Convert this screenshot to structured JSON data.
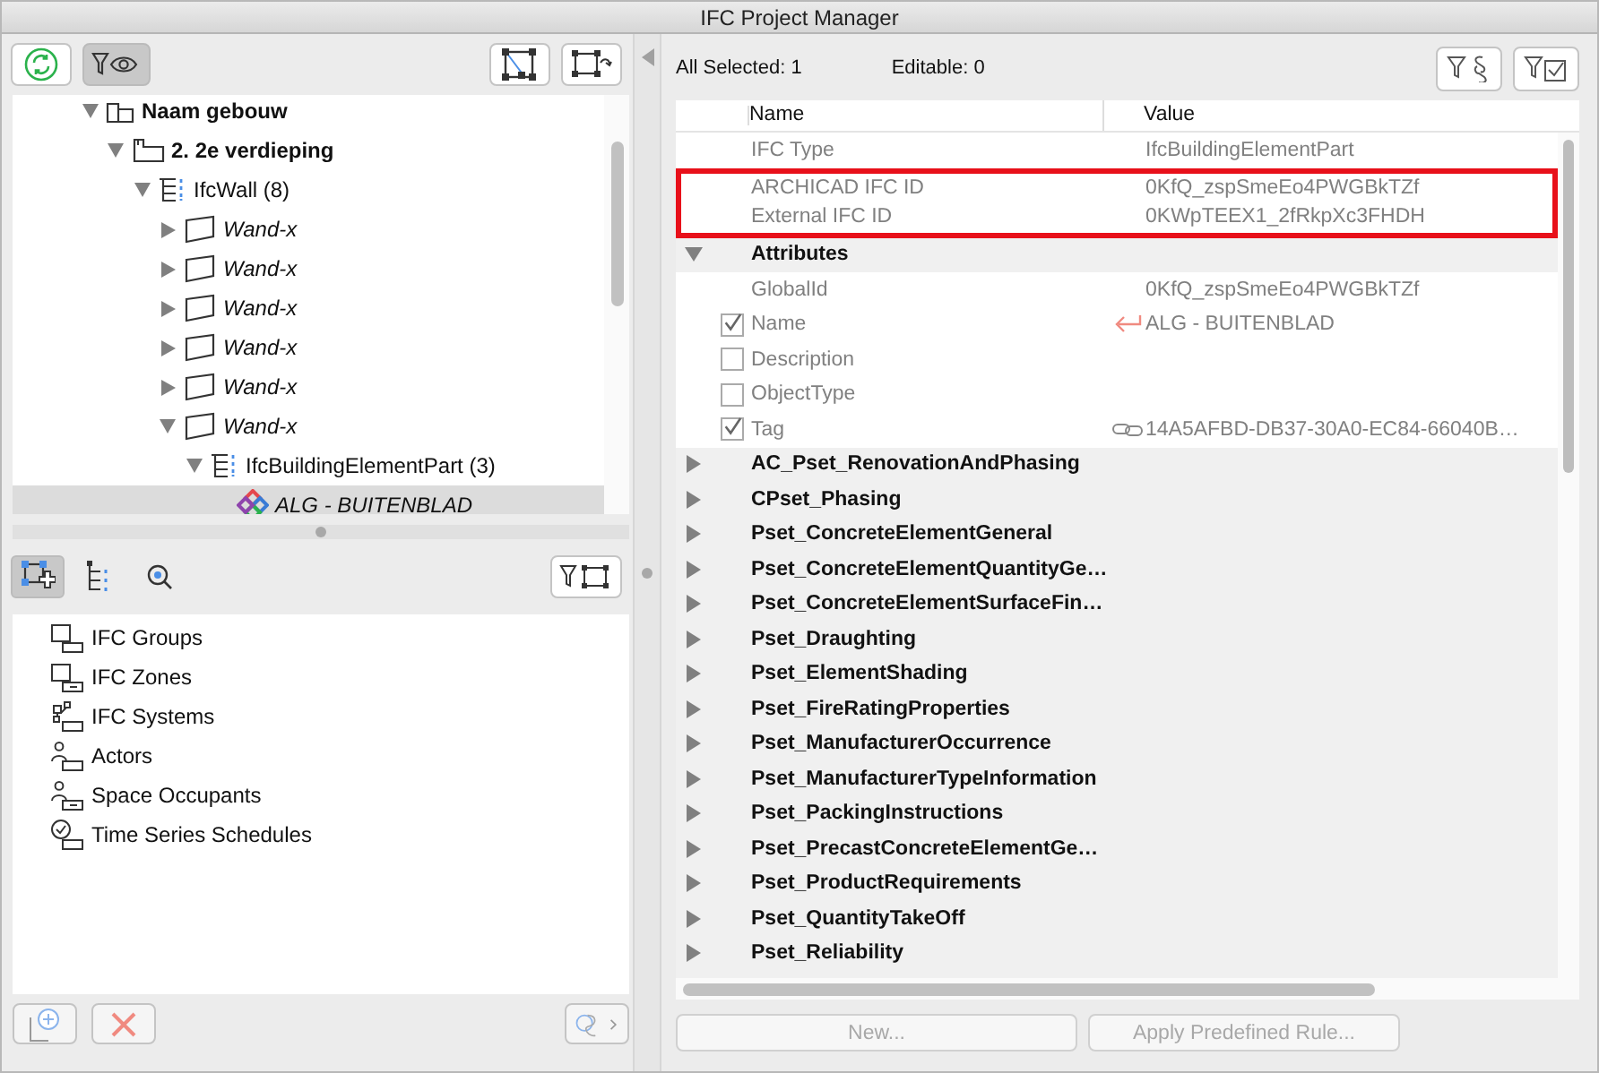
{
  "window": {
    "title": "IFC Project Manager"
  },
  "left_toolbar": {
    "filter_toggle_pressed": true
  },
  "tree": [
    {
      "label": "Naam gebouw",
      "kind": "building",
      "expanded": true,
      "selected": false,
      "children": [
        {
          "label": "2. 2e verdieping",
          "kind": "storey",
          "expanded": true,
          "selected": false,
          "children": [
            {
              "label": "IfcWall (8)",
              "kind": "ifc-class",
              "expanded": true,
              "selected": false,
              "children": [
                {
                  "label": "Wand-x",
                  "kind": "element",
                  "expanded": false,
                  "selected": false
                },
                {
                  "label": "Wand-x",
                  "kind": "element",
                  "expanded": false,
                  "selected": false
                },
                {
                  "label": "Wand-x",
                  "kind": "element",
                  "expanded": false,
                  "selected": false
                },
                {
                  "label": "Wand-x",
                  "kind": "element",
                  "expanded": false,
                  "selected": false
                },
                {
                  "label": "Wand-x",
                  "kind": "element",
                  "expanded": false,
                  "selected": false
                },
                {
                  "label": "Wand-x",
                  "kind": "element",
                  "expanded": true,
                  "selected": false,
                  "children": [
                    {
                      "label": "IfcBuildingElementPart (3)",
                      "kind": "ifc-class",
                      "expanded": true,
                      "selected": false,
                      "children": [
                        {
                          "label": "ALG - BUITENBLAD",
                          "kind": "part",
                          "selected": true
                        }
                      ]
                    }
                  ]
                }
              ]
            }
          ]
        }
      ]
    }
  ],
  "view_tabs": [
    {
      "kind": "groups",
      "selected": true
    },
    {
      "kind": "hierarchy",
      "selected": false
    },
    {
      "kind": "search",
      "selected": false
    }
  ],
  "group_list": [
    {
      "label": "IFC Groups",
      "kind": "groups"
    },
    {
      "label": "IFC Zones",
      "kind": "zones"
    },
    {
      "label": "IFC Systems",
      "kind": "systems"
    },
    {
      "label": "Actors",
      "kind": "actors"
    },
    {
      "label": "Space Occupants",
      "kind": "occupants"
    },
    {
      "label": "Time Series Schedules",
      "kind": "schedules"
    }
  ],
  "summary": {
    "all_selected": "All Selected: 1",
    "editable": "Editable: 0"
  },
  "table": {
    "columns": [
      "Name",
      "Value"
    ],
    "rows": [
      {
        "kind": "info",
        "name": "IFC Type",
        "value": "IfcBuildingElementPart",
        "highlighted": false
      },
      {
        "kind": "info",
        "name": "ARCHICAD IFC ID",
        "value": "0KfQ_zspSmeEo4PWGBkTZf",
        "highlighted": true
      },
      {
        "kind": "info",
        "name": "External IFC ID",
        "value": "0KWpTEEX1_2fRkpXc3FHDH",
        "highlighted": true
      },
      {
        "kind": "group",
        "name": "Attributes",
        "expanded": true
      },
      {
        "kind": "attribute",
        "name": "GlobalId",
        "value": "0KfQ_zspSmeEo4PWGBkTZf"
      },
      {
        "kind": "attribute",
        "name": "Name",
        "value": "ALG - BUITENBLAD",
        "checked": true,
        "value_icon": {
          "kind": "return"
        }
      },
      {
        "kind": "attribute",
        "name": "Description",
        "checked": false
      },
      {
        "kind": "attribute",
        "name": "ObjectType",
        "checked": false
      },
      {
        "kind": "attribute",
        "name": "Tag",
        "value": "14A5AFBD-DB37-30A0-EC84-66040B…",
        "checked": true,
        "value_icon": {
          "kind": "link"
        }
      },
      {
        "kind": "group",
        "name": "AC_Pset_RenovationAndPhasing",
        "expanded": false
      },
      {
        "kind": "group",
        "name": "CPset_Phasing",
        "expanded": false
      },
      {
        "kind": "group",
        "name": "Pset_ConcreteElementGeneral",
        "expanded": false
      },
      {
        "kind": "group",
        "name": "Pset_ConcreteElementQuantityGe…",
        "expanded": false
      },
      {
        "kind": "group",
        "name": "Pset_ConcreteElementSurfaceFin…",
        "expanded": false
      },
      {
        "kind": "group",
        "name": "Pset_Draughting",
        "expanded": false
      },
      {
        "kind": "group",
        "name": "Pset_ElementShading",
        "expanded": false
      },
      {
        "kind": "group",
        "name": "Pset_FireRatingProperties",
        "expanded": false
      },
      {
        "kind": "group",
        "name": "Pset_ManufacturerOccurrence",
        "expanded": false
      },
      {
        "kind": "group",
        "name": "Pset_ManufacturerTypeInformation",
        "expanded": false
      },
      {
        "kind": "group",
        "name": "Pset_PackingInstructions",
        "expanded": false
      },
      {
        "kind": "group",
        "name": "Pset_PrecastConcreteElementGe…",
        "expanded": false
      },
      {
        "kind": "group",
        "name": "Pset_ProductRequirements",
        "expanded": false
      },
      {
        "kind": "group",
        "name": "Pset_QuantityTakeOff",
        "expanded": false
      },
      {
        "kind": "group",
        "name": "Pset_Reliability",
        "expanded": false
      }
    ]
  },
  "buttons": [
    {
      "label": "New...",
      "disabled": true
    },
    {
      "label": "Apply Predefined Rule...",
      "disabled": true
    }
  ]
}
